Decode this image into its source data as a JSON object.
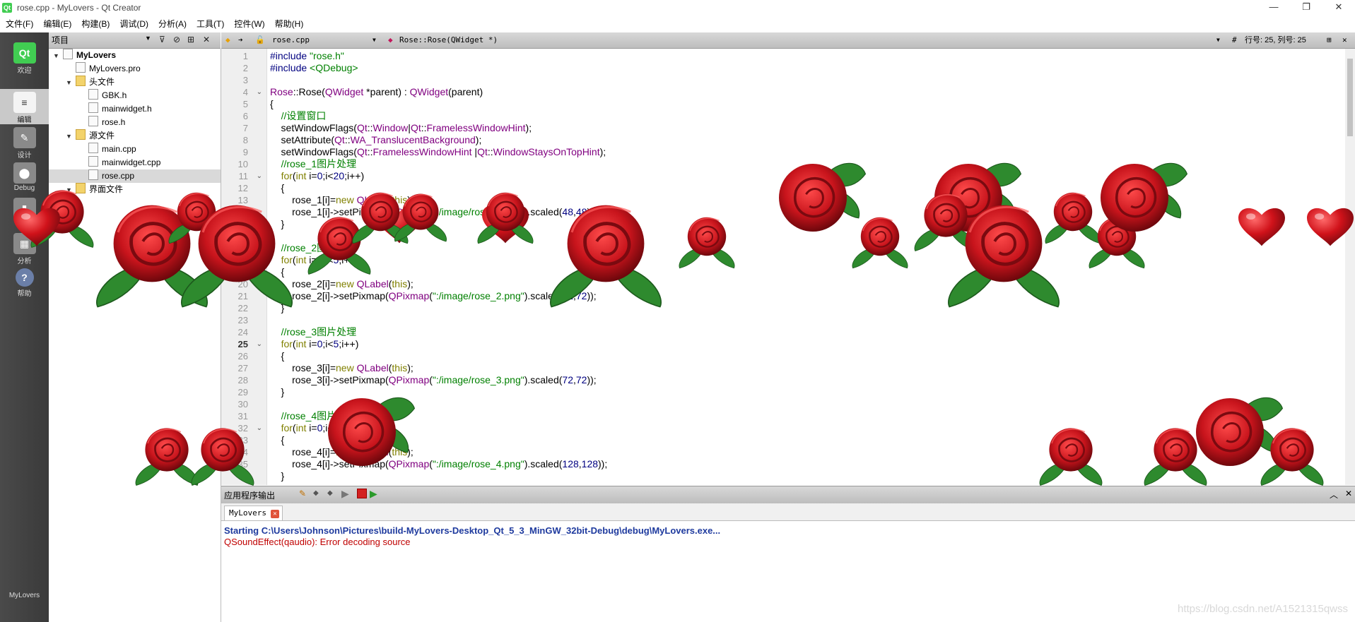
{
  "window": {
    "title": "rose.cpp - MyLovers - Qt Creator",
    "app_icon": "Qt",
    "minimize": "—",
    "restore": "❐",
    "close": "✕"
  },
  "menu": [
    "文件(F)",
    "编辑(E)",
    "构建(B)",
    "调试(D)",
    "分析(A)",
    "工具(T)",
    "控件(W)",
    "帮助(H)"
  ],
  "modes": [
    {
      "icon": "Qt",
      "label": "欢迎"
    },
    {
      "icon": "≡",
      "label": "编辑"
    },
    {
      "icon": "✎",
      "label": "设计"
    },
    {
      "icon": "⬤",
      "label": "Debug"
    },
    {
      "icon": "▮",
      "label": "项目"
    },
    {
      "icon": "▦",
      "label": "分析"
    },
    {
      "icon": "?",
      "label": "帮助"
    }
  ],
  "kit_label": "MyLovers",
  "sidebar": {
    "selector": "项目",
    "tree": [
      {
        "label": "MyLovers",
        "level": 0,
        "arrow": "▼",
        "icon": "",
        "bold": true
      },
      {
        "label": "MyLovers.pro",
        "level": 1,
        "arrow": "",
        "icon": "pro"
      },
      {
        "label": "头文件",
        "level": 1,
        "arrow": "▼",
        "icon": "h"
      },
      {
        "label": "GBK.h",
        "level": 2,
        "arrow": "",
        "icon": "h"
      },
      {
        "label": "mainwidget.h",
        "level": 2,
        "arrow": "",
        "icon": "h"
      },
      {
        "label": "rose.h",
        "level": 2,
        "arrow": "",
        "icon": "h"
      },
      {
        "label": "源文件",
        "level": 1,
        "arrow": "▼",
        "icon": "c"
      },
      {
        "label": "main.cpp",
        "level": 2,
        "arrow": "",
        "icon": "c"
      },
      {
        "label": "mainwidget.cpp",
        "level": 2,
        "arrow": "",
        "icon": "c"
      },
      {
        "label": "rose.cpp",
        "level": 2,
        "arrow": "",
        "icon": "c",
        "selected": true
      },
      {
        "label": "界面文件",
        "level": 1,
        "arrow": "▼",
        "icon": "ui"
      }
    ]
  },
  "editor": {
    "file": "rose.cpp",
    "symbol": "Rose::Rose(QWidget *)",
    "hash": "#",
    "position": "行号: 25, 列号: 25",
    "current_line": 25,
    "line_numbers": [
      "1",
      "2",
      "3",
      "4",
      "5",
      "6",
      "7",
      "8",
      "9",
      "10",
      "11",
      "12",
      "13",
      "14",
      "15",
      "16",
      "17",
      "18",
      "19",
      "20",
      "21",
      "22",
      "23",
      "24",
      "25",
      "26",
      "27",
      "28",
      "29",
      "30",
      "31",
      "32",
      "33",
      "34",
      "35",
      "36"
    ],
    "fold_lines": [
      4,
      11,
      25,
      32
    ],
    "lines": [
      [
        [
          "pp",
          "#include "
        ],
        [
          "str",
          "\"rose.h\""
        ]
      ],
      [
        [
          "pp",
          "#include "
        ],
        [
          "str",
          "<QDebug>"
        ]
      ],
      [],
      [
        [
          "cls",
          "Rose"
        ],
        [
          "t",
          "::Rose("
        ],
        [
          "cls",
          "QWidget"
        ],
        [
          "t",
          " *parent) : "
        ],
        [
          "cls",
          "QWidget"
        ],
        [
          "t",
          "(parent)"
        ]
      ],
      [
        [
          "t",
          "{"
        ]
      ],
      [
        [
          "t",
          "    "
        ],
        [
          "cm",
          "//设置窗口"
        ]
      ],
      [
        [
          "t",
          "    setWindowFlags("
        ],
        [
          "cls",
          "Qt"
        ],
        [
          "t",
          "::"
        ],
        [
          "cls",
          "Window"
        ],
        [
          "t",
          "|"
        ],
        [
          "cls",
          "Qt"
        ],
        [
          "t",
          "::"
        ],
        [
          "cls",
          "FramelessWindowHint"
        ],
        [
          "t",
          ");"
        ]
      ],
      [
        [
          "t",
          "    setAttribute("
        ],
        [
          "cls",
          "Qt"
        ],
        [
          "t",
          "::"
        ],
        [
          "cls",
          "WA_TranslucentBackground"
        ],
        [
          "t",
          ");"
        ]
      ],
      [
        [
          "t",
          "    setWindowFlags("
        ],
        [
          "cls",
          "Qt"
        ],
        [
          "t",
          "::"
        ],
        [
          "cls",
          "FramelessWindowHint"
        ],
        [
          "t",
          " |"
        ],
        [
          "cls",
          "Qt"
        ],
        [
          "t",
          "::"
        ],
        [
          "cls",
          "WindowStaysOnTopHint"
        ],
        [
          "t",
          ");"
        ]
      ],
      [
        [
          "t",
          "    "
        ],
        [
          "cm",
          "//rose_1图片处理"
        ]
      ],
      [
        [
          "t",
          "    "
        ],
        [
          "kw",
          "for"
        ],
        [
          "t",
          "("
        ],
        [
          "kw",
          "int"
        ],
        [
          "t",
          " i="
        ],
        [
          "num",
          "0"
        ],
        [
          "t",
          ";i<"
        ],
        [
          "num",
          "20"
        ],
        [
          "t",
          ";i++)"
        ]
      ],
      [
        [
          "t",
          "    {"
        ]
      ],
      [
        [
          "t",
          "        rose_1[i]="
        ],
        [
          "kw",
          "new"
        ],
        [
          "t",
          " "
        ],
        [
          "cls",
          "QLabel"
        ],
        [
          "t",
          "("
        ],
        [
          "kw",
          "this"
        ],
        [
          "t",
          ");"
        ]
      ],
      [
        [
          "t",
          "        rose_1[i]->setPixmap("
        ],
        [
          "cls",
          "QPixmap"
        ],
        [
          "t",
          "("
        ],
        [
          "str",
          "\":/image/rose_1.png\""
        ],
        [
          "t",
          ").scaled("
        ],
        [
          "num",
          "48"
        ],
        [
          "t",
          ","
        ],
        [
          "num",
          "48"
        ],
        [
          "t",
          "));"
        ]
      ],
      [
        [
          "t",
          "    }"
        ]
      ],
      [],
      [
        [
          "t",
          "    "
        ],
        [
          "cm",
          "//rose_2图片处理"
        ]
      ],
      [
        [
          "t",
          "    "
        ],
        [
          "kw",
          "for"
        ],
        [
          "t",
          "("
        ],
        [
          "kw",
          "int"
        ],
        [
          "t",
          " i="
        ],
        [
          "num",
          "0"
        ],
        [
          "t",
          ";i<"
        ],
        [
          "num",
          "5"
        ],
        [
          "t",
          ";i++)"
        ]
      ],
      [
        [
          "t",
          "    {"
        ]
      ],
      [
        [
          "t",
          "        rose_2[i]="
        ],
        [
          "kw",
          "new"
        ],
        [
          "t",
          " "
        ],
        [
          "cls",
          "QLabel"
        ],
        [
          "t",
          "("
        ],
        [
          "kw",
          "this"
        ],
        [
          "t",
          ");"
        ]
      ],
      [
        [
          "t",
          "        rose_2[i]->setPixmap("
        ],
        [
          "cls",
          "QPixmap"
        ],
        [
          "t",
          "("
        ],
        [
          "str",
          "\":/image/rose_2.png\""
        ],
        [
          "t",
          ").scaled("
        ],
        [
          "num",
          "72"
        ],
        [
          "t",
          ","
        ],
        [
          "num",
          "72"
        ],
        [
          "t",
          "));"
        ]
      ],
      [
        [
          "t",
          "    }"
        ]
      ],
      [],
      [
        [
          "t",
          "    "
        ],
        [
          "cm",
          "//rose_3图片处理"
        ]
      ],
      [
        [
          "t",
          "    "
        ],
        [
          "kw",
          "for"
        ],
        [
          "t",
          "("
        ],
        [
          "kw",
          "int"
        ],
        [
          "t",
          " i="
        ],
        [
          "num",
          "0"
        ],
        [
          "t",
          ";i<"
        ],
        [
          "num",
          "5"
        ],
        [
          "t",
          ";i++)"
        ]
      ],
      [
        [
          "t",
          "    {"
        ]
      ],
      [
        [
          "t",
          "        rose_3[i]="
        ],
        [
          "kw",
          "new"
        ],
        [
          "t",
          " "
        ],
        [
          "cls",
          "QLabel"
        ],
        [
          "t",
          "("
        ],
        [
          "kw",
          "this"
        ],
        [
          "t",
          ");"
        ]
      ],
      [
        [
          "t",
          "        rose_3[i]->setPixmap("
        ],
        [
          "cls",
          "QPixmap"
        ],
        [
          "t",
          "("
        ],
        [
          "str",
          "\":/image/rose_3.png\""
        ],
        [
          "t",
          ").scaled("
        ],
        [
          "num",
          "72"
        ],
        [
          "t",
          ","
        ],
        [
          "num",
          "72"
        ],
        [
          "t",
          "));"
        ]
      ],
      [
        [
          "t",
          "    }"
        ]
      ],
      [],
      [
        [
          "t",
          "    "
        ],
        [
          "cm",
          "//rose_4图片处理"
        ]
      ],
      [
        [
          "t",
          "    "
        ],
        [
          "kw",
          "for"
        ],
        [
          "t",
          "("
        ],
        [
          "kw",
          "int"
        ],
        [
          "t",
          " i="
        ],
        [
          "num",
          "0"
        ],
        [
          "t",
          ";i<"
        ],
        [
          "num",
          "5"
        ],
        [
          "t",
          ";i++)"
        ]
      ],
      [
        [
          "t",
          "    {"
        ]
      ],
      [
        [
          "t",
          "        rose_4[i]="
        ],
        [
          "kw",
          "new"
        ],
        [
          "t",
          " "
        ],
        [
          "cls",
          "QLabel"
        ],
        [
          "t",
          "("
        ],
        [
          "kw",
          "this"
        ],
        [
          "t",
          ");"
        ]
      ],
      [
        [
          "t",
          "        rose_4[i]->setPixmap("
        ],
        [
          "cls",
          "QPixmap"
        ],
        [
          "t",
          "("
        ],
        [
          "str",
          "\":/image/rose_4.png\""
        ],
        [
          "t",
          ").scaled("
        ],
        [
          "num",
          "128"
        ],
        [
          "t",
          ","
        ],
        [
          "num",
          "128"
        ],
        [
          "t",
          "));"
        ]
      ],
      [
        [
          "t",
          "    }"
        ]
      ]
    ]
  },
  "output": {
    "header": "应用程序输出",
    "tab": "MyLovers",
    "lines": [
      "Starting C:\\Users\\Johnson\\Pictures\\build-MyLovers-Desktop_Qt_5_3_MinGW_32bit-Debug\\debug\\MyLovers.exe...",
      "QSoundEffect(qaudio): Error decoding source"
    ]
  },
  "watermark": "https://blog.csdn.net/A1521315qwss",
  "colors": {
    "rose": "#c8141c",
    "rose_dark": "#7a0a10",
    "leaf": "#2e8a2e",
    "heart": "#d0121a"
  }
}
